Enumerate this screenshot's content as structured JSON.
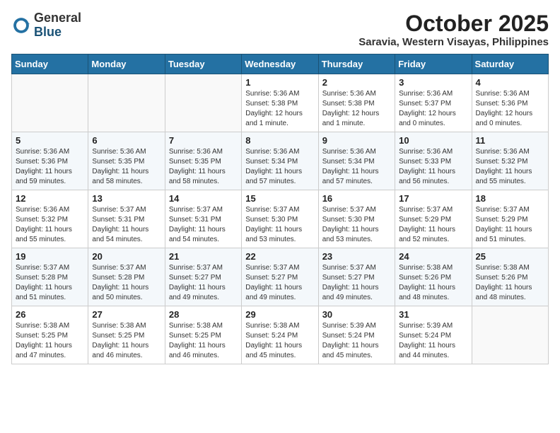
{
  "header": {
    "logo_general": "General",
    "logo_blue": "Blue",
    "month_title": "October 2025",
    "location": "Saravia, Western Visayas, Philippines"
  },
  "days_of_week": [
    "Sunday",
    "Monday",
    "Tuesday",
    "Wednesday",
    "Thursday",
    "Friday",
    "Saturday"
  ],
  "weeks": [
    [
      {
        "day": "",
        "info": ""
      },
      {
        "day": "",
        "info": ""
      },
      {
        "day": "",
        "info": ""
      },
      {
        "day": "1",
        "info": "Sunrise: 5:36 AM\nSunset: 5:38 PM\nDaylight: 12 hours\nand 1 minute."
      },
      {
        "day": "2",
        "info": "Sunrise: 5:36 AM\nSunset: 5:38 PM\nDaylight: 12 hours\nand 1 minute."
      },
      {
        "day": "3",
        "info": "Sunrise: 5:36 AM\nSunset: 5:37 PM\nDaylight: 12 hours\nand 0 minutes."
      },
      {
        "day": "4",
        "info": "Sunrise: 5:36 AM\nSunset: 5:36 PM\nDaylight: 12 hours\nand 0 minutes."
      }
    ],
    [
      {
        "day": "5",
        "info": "Sunrise: 5:36 AM\nSunset: 5:36 PM\nDaylight: 11 hours\nand 59 minutes."
      },
      {
        "day": "6",
        "info": "Sunrise: 5:36 AM\nSunset: 5:35 PM\nDaylight: 11 hours\nand 58 minutes."
      },
      {
        "day": "7",
        "info": "Sunrise: 5:36 AM\nSunset: 5:35 PM\nDaylight: 11 hours\nand 58 minutes."
      },
      {
        "day": "8",
        "info": "Sunrise: 5:36 AM\nSunset: 5:34 PM\nDaylight: 11 hours\nand 57 minutes."
      },
      {
        "day": "9",
        "info": "Sunrise: 5:36 AM\nSunset: 5:34 PM\nDaylight: 11 hours\nand 57 minutes."
      },
      {
        "day": "10",
        "info": "Sunrise: 5:36 AM\nSunset: 5:33 PM\nDaylight: 11 hours\nand 56 minutes."
      },
      {
        "day": "11",
        "info": "Sunrise: 5:36 AM\nSunset: 5:32 PM\nDaylight: 11 hours\nand 55 minutes."
      }
    ],
    [
      {
        "day": "12",
        "info": "Sunrise: 5:36 AM\nSunset: 5:32 PM\nDaylight: 11 hours\nand 55 minutes."
      },
      {
        "day": "13",
        "info": "Sunrise: 5:37 AM\nSunset: 5:31 PM\nDaylight: 11 hours\nand 54 minutes."
      },
      {
        "day": "14",
        "info": "Sunrise: 5:37 AM\nSunset: 5:31 PM\nDaylight: 11 hours\nand 54 minutes."
      },
      {
        "day": "15",
        "info": "Sunrise: 5:37 AM\nSunset: 5:30 PM\nDaylight: 11 hours\nand 53 minutes."
      },
      {
        "day": "16",
        "info": "Sunrise: 5:37 AM\nSunset: 5:30 PM\nDaylight: 11 hours\nand 53 minutes."
      },
      {
        "day": "17",
        "info": "Sunrise: 5:37 AM\nSunset: 5:29 PM\nDaylight: 11 hours\nand 52 minutes."
      },
      {
        "day": "18",
        "info": "Sunrise: 5:37 AM\nSunset: 5:29 PM\nDaylight: 11 hours\nand 51 minutes."
      }
    ],
    [
      {
        "day": "19",
        "info": "Sunrise: 5:37 AM\nSunset: 5:28 PM\nDaylight: 11 hours\nand 51 minutes."
      },
      {
        "day": "20",
        "info": "Sunrise: 5:37 AM\nSunset: 5:28 PM\nDaylight: 11 hours\nand 50 minutes."
      },
      {
        "day": "21",
        "info": "Sunrise: 5:37 AM\nSunset: 5:27 PM\nDaylight: 11 hours\nand 49 minutes."
      },
      {
        "day": "22",
        "info": "Sunrise: 5:37 AM\nSunset: 5:27 PM\nDaylight: 11 hours\nand 49 minutes."
      },
      {
        "day": "23",
        "info": "Sunrise: 5:37 AM\nSunset: 5:27 PM\nDaylight: 11 hours\nand 49 minutes."
      },
      {
        "day": "24",
        "info": "Sunrise: 5:38 AM\nSunset: 5:26 PM\nDaylight: 11 hours\nand 48 minutes."
      },
      {
        "day": "25",
        "info": "Sunrise: 5:38 AM\nSunset: 5:26 PM\nDaylight: 11 hours\nand 48 minutes."
      }
    ],
    [
      {
        "day": "26",
        "info": "Sunrise: 5:38 AM\nSunset: 5:25 PM\nDaylight: 11 hours\nand 47 minutes."
      },
      {
        "day": "27",
        "info": "Sunrise: 5:38 AM\nSunset: 5:25 PM\nDaylight: 11 hours\nand 46 minutes."
      },
      {
        "day": "28",
        "info": "Sunrise: 5:38 AM\nSunset: 5:25 PM\nDaylight: 11 hours\nand 46 minutes."
      },
      {
        "day": "29",
        "info": "Sunrise: 5:38 AM\nSunset: 5:24 PM\nDaylight: 11 hours\nand 45 minutes."
      },
      {
        "day": "30",
        "info": "Sunrise: 5:39 AM\nSunset: 5:24 PM\nDaylight: 11 hours\nand 45 minutes."
      },
      {
        "day": "31",
        "info": "Sunrise: 5:39 AM\nSunset: 5:24 PM\nDaylight: 11 hours\nand 44 minutes."
      },
      {
        "day": "",
        "info": ""
      }
    ]
  ]
}
